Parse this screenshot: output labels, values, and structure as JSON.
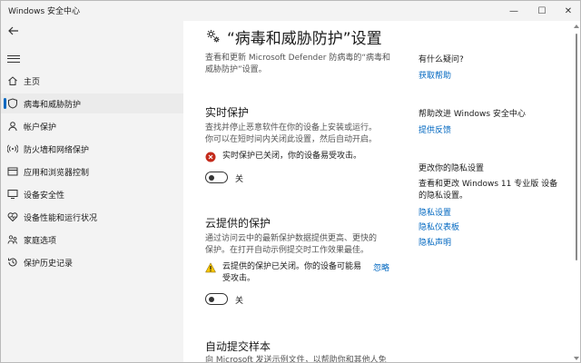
{
  "window": {
    "title": "Windows 安全中心",
    "controls": {
      "minimize": "—",
      "maximize": "☐",
      "close": "✕"
    }
  },
  "sidebar": {
    "items": [
      {
        "label": "主页",
        "icon": "home-icon",
        "active": false
      },
      {
        "label": "病毒和威胁防护",
        "icon": "shield-icon",
        "active": true
      },
      {
        "label": "帐户保护",
        "icon": "person-icon",
        "active": false
      },
      {
        "label": "防火墙和网络保护",
        "icon": "wifi-icon",
        "active": false
      },
      {
        "label": "应用和浏览器控制",
        "icon": "app-window-icon",
        "active": false
      },
      {
        "label": "设备安全性",
        "icon": "monitor-icon",
        "active": false
      },
      {
        "label": "设备性能和运行状况",
        "icon": "heart-icon",
        "active": false
      },
      {
        "label": "家庭选项",
        "icon": "family-icon",
        "active": false
      },
      {
        "label": "保护历史记录",
        "icon": "history-icon",
        "active": false
      }
    ]
  },
  "main": {
    "title": "“病毒和威胁防护”设置",
    "description": [
      "查看和更新 Microsoft Defender 防病毒的“病毒和",
      "威胁防护”设置。"
    ],
    "realtime": {
      "title": "实时保护",
      "description": [
        "查找并停止恶意软件在你的设备上安装或运行。",
        "你可以在短时间内关闭此设置，然后自动开启。"
      ],
      "status": "实时保护已关闭，你的设备易受攻击。",
      "toggle_label": "关",
      "on": false
    },
    "cloud": {
      "title": "云提供的保护",
      "description": [
        "通过访问云中的最新保护数据提供更高、更快的",
        "保护。在打开自动示例提交时工作效果最佳。"
      ],
      "status_line1": "云提供的保护已关闭。你的设备可能易",
      "status_line2": "受攻击。",
      "dismiss": "忽略",
      "toggle_label": "关",
      "on": false
    },
    "sample": {
      "title": "自动提交样本",
      "description_partial": "向 Microsoft 发送示例文件，以帮助你和其他人免"
    }
  },
  "right": {
    "question": {
      "heading": "有什么疑问?",
      "link": "获取帮助"
    },
    "improve": {
      "heading": "帮助改进 Windows 安全中心",
      "link": "提供反馈"
    },
    "privacy": {
      "heading": "更改你的隐私设置",
      "text": [
        "查看和更改 Windows 11 专业版 设备",
        "的隐私设置。"
      ],
      "links": [
        "隐私设置",
        "隐私仪表板",
        "隐私声明"
      ]
    }
  },
  "colors": {
    "accent": "#0067c0",
    "error": "#c42b1c",
    "warning": "#f7c600",
    "sidebar_bg": "#f3f3f3"
  }
}
